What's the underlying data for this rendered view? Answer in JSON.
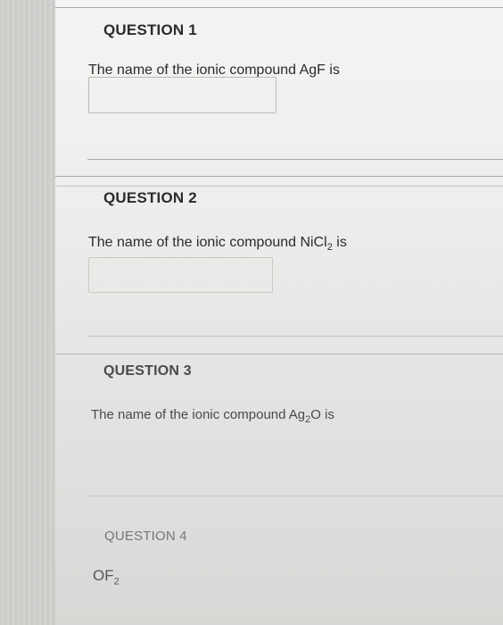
{
  "questions": [
    {
      "title": "QUESTION 1",
      "prompt_before": "The name of the ionic compound AgF is",
      "sub": "",
      "prompt_after": ""
    },
    {
      "title": "QUESTION 2",
      "prompt_before": "The name of the ionic compound NiCl",
      "sub": "2",
      "prompt_after": " is"
    },
    {
      "title": "QUESTION 3",
      "prompt_before": "The name of the ionic compound Ag",
      "sub": "2",
      "prompt_after": "O is"
    },
    {
      "title": "QUESTION 4",
      "prompt_before": "OF",
      "sub": "2",
      "prompt_after": ""
    }
  ]
}
